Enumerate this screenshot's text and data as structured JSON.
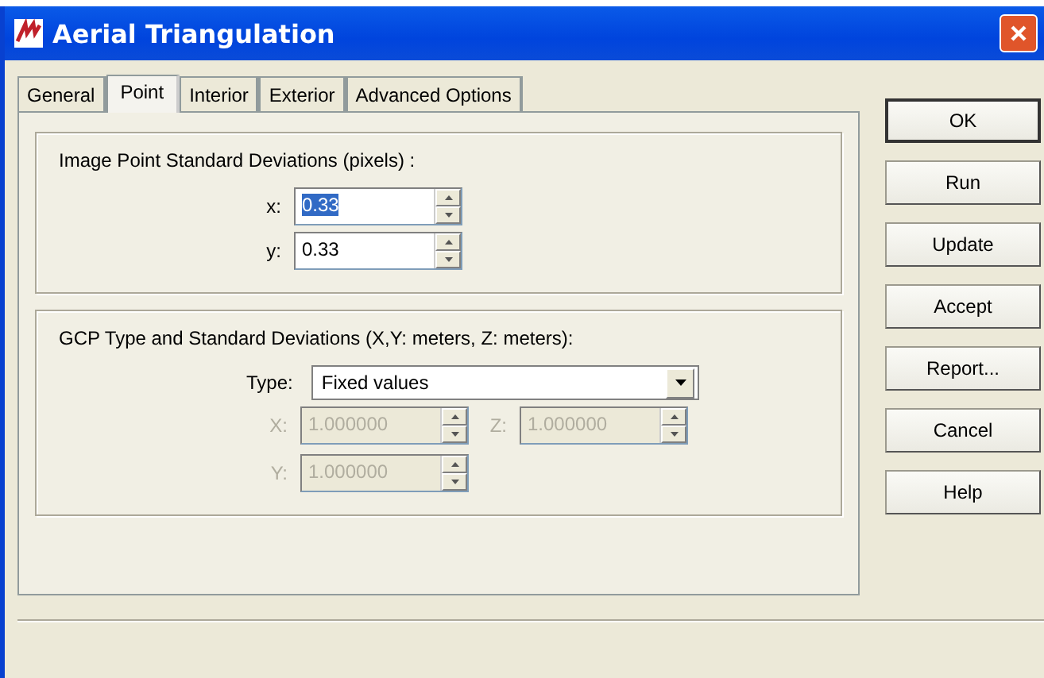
{
  "window": {
    "title": "Aerial Triangulation"
  },
  "tabs": [
    {
      "label": "General",
      "selected": false
    },
    {
      "label": "Point",
      "selected": true
    },
    {
      "label": "Interior",
      "selected": false
    },
    {
      "label": "Exterior",
      "selected": false
    },
    {
      "label": "Advanced Options",
      "selected": false
    }
  ],
  "point_group": {
    "title": "Image Point Standard Deviations (pixels) :",
    "fields": [
      {
        "label": "x:",
        "value": "0.33",
        "selected": true,
        "disabled": false
      },
      {
        "label": "y:",
        "value": "0.33",
        "selected": false,
        "disabled": false
      }
    ]
  },
  "gcp_group": {
    "title": "GCP Type and Standard Deviations (X,Y: meters, Z: meters):",
    "type": {
      "label": "Type:",
      "value": "Fixed values"
    },
    "fields": [
      {
        "label": "X:",
        "value": "1.000000",
        "selected": false,
        "disabled": true
      },
      {
        "label": "Z:",
        "value": "1.000000",
        "selected": false,
        "disabled": true
      },
      {
        "label": "Y:",
        "value": "1.000000",
        "selected": false,
        "disabled": true
      }
    ]
  },
  "buttons": [
    {
      "label": "OK",
      "default": true
    },
    {
      "label": "Run",
      "default": false
    },
    {
      "label": "Update",
      "default": false
    },
    {
      "label": "Accept",
      "default": false
    },
    {
      "label": "Report...",
      "default": false
    },
    {
      "label": "Cancel",
      "default": false
    },
    {
      "label": "Help",
      "default": false
    }
  ]
}
